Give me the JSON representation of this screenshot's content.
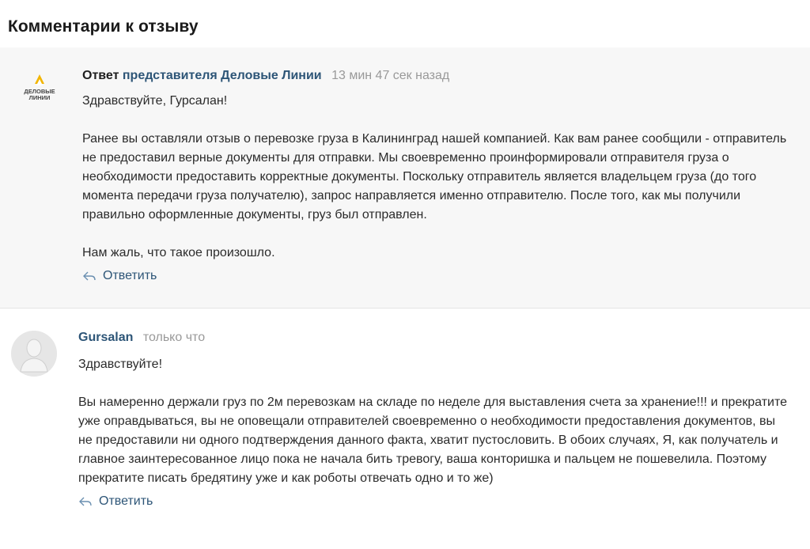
{
  "page": {
    "title": "Комментарии к отзыву"
  },
  "comments": [
    {
      "author_prefix": "Ответ",
      "author_name": "представителя Деловые Линии",
      "timestamp": "13 мин 47 сек назад",
      "logo_text_line1": "ДЕЛОВЫЕ",
      "logo_text_line2": "ЛИНИИ",
      "greeting": "Здравствуйте, Гурсалан!",
      "paragraph": "Ранее вы оставляли отзыв о перевозке груза в Калининград нашей компанией. Как вам ранее сообщили - отправитель не предоставил верные документы для отправки. Мы своевременно проинформировали отправителя груза о необходимости предоставить корректные документы. Поскольку отправитель является владельцем груза (до того момента передачи груза получателю), запрос направляется именно отправителю. После того, как мы получили правильно оформленные документы, груз был отправлен.",
      "closing": "Нам жаль, что такое произошло.",
      "reply_label": "Ответить"
    },
    {
      "author_name": "Gursalan",
      "timestamp": "только что",
      "greeting": "Здравствуйте!",
      "paragraph": "Вы намеренно держали груз по 2м перевозкам на складе по неделе для выставления счета за хранение!!! и прекратите уже оправдываться, вы не оповещали отправителей своевременно о необходимости предоставления документов, вы не предоставили ни одного подтверждения данного факта, хватит пустословить. В обоих случаях, Я, как получатель и главное заинтересованное лицо пока не начала бить тревогу, ваша конторишка и пальцем не пошевелила. Поэтому прекратите писать бредятину уже и как роботы отвечать одно и то же)",
      "reply_label": "Ответить"
    }
  ],
  "colors": {
    "link": "#2d5577",
    "timestamp": "#999999",
    "logo_accent": "#f2b500",
    "highlight_bg": "#f7f7f7"
  },
  "icons": {
    "company_logo": "delovye-linii-logo",
    "avatar": "user-avatar-icon",
    "reply": "reply-arrow-icon"
  }
}
